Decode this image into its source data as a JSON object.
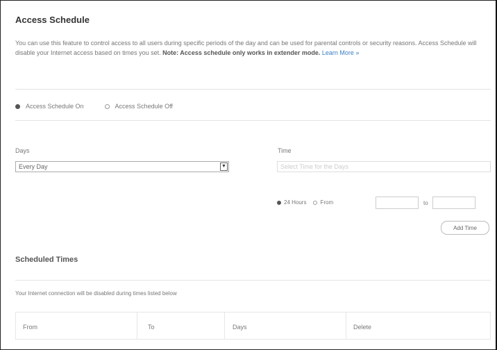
{
  "header": {
    "title": "Access Schedule"
  },
  "description": {
    "text": "You can use this feature to control access to all users during specific periods of the day and can be used for parental controls or security reasons. Access Schedule will disable your Internet access based on times you set.",
    "note": "Note: Access schedule only works in extender mode.",
    "link": "Learn More »"
  },
  "toggle": {
    "on_label": "Access Schedule On",
    "off_label": "Access Schedule Off",
    "selected": "on"
  },
  "form": {
    "days_label": "Days",
    "days_value": "Every Day",
    "time_label": "Time",
    "time_placeholder": "Select Time for the Days",
    "hours_label": "24 Hours",
    "from_label": "From",
    "to_label": "to",
    "add_time_label": "Add Time"
  },
  "scheduled": {
    "title": "Scheduled Times",
    "note": "Your Internet connection will be disabled during times listed below",
    "columns": [
      "From",
      "To",
      "Days",
      "Delete"
    ]
  },
  "colors": {
    "link": "#3b7fc4",
    "text": "#777777"
  }
}
